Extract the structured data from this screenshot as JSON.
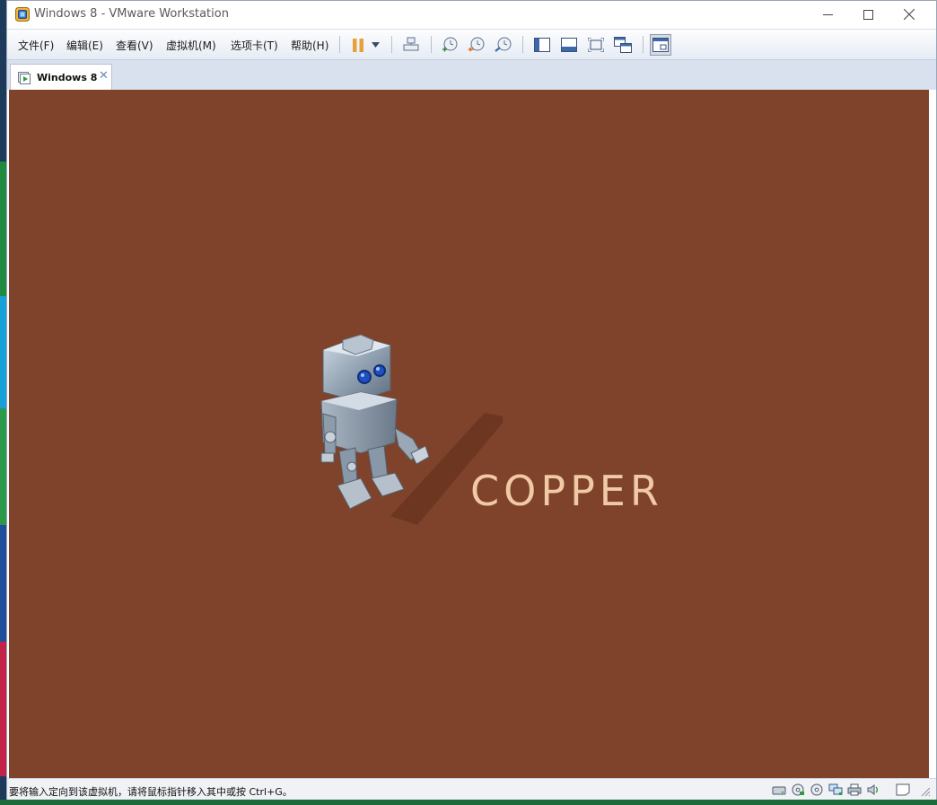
{
  "window": {
    "title": "Windows 8 - VMware Workstation"
  },
  "menu": {
    "items": [
      "文件(F)",
      "编辑(E)",
      "查看(V)",
      "虚拟机(M)",
      "选项卡(T)",
      "帮助(H)"
    ]
  },
  "toolbar": {
    "buttons": [
      {
        "icon": "pause-icon"
      },
      {
        "icon": "dropdown-arrow-icon"
      },
      {
        "icon": "send-ctrl-alt-del-icon"
      },
      {
        "icon": "snapshot-take-icon"
      },
      {
        "icon": "snapshot-revert-icon"
      },
      {
        "icon": "snapshot-manager-icon"
      },
      {
        "icon": "show-library-icon"
      },
      {
        "icon": "thumbnail-bar-icon"
      },
      {
        "icon": "fullscreen-icon"
      },
      {
        "icon": "unity-icon"
      },
      {
        "icon": "console-view-icon"
      }
    ]
  },
  "tabs": [
    {
      "label": "Windows 8",
      "close": "✕"
    }
  ],
  "vm": {
    "brand_text": "COPPER",
    "background": "#7f422a",
    "text_color": "#f0c9a6"
  },
  "status": {
    "message": "要将输入定向到该虚拟机，请将鼠标指针移入其中或按 Ctrl+G。",
    "device_icons": [
      "hard-disk-icon",
      "cd-dvd-icon",
      "cd-dvd-2-icon",
      "network-adapter-icon",
      "printer-icon",
      "sound-card-icon",
      "message-log-icon"
    ]
  },
  "colors": {
    "accent": "#e8a13a",
    "tab_strip": "#d9e1ee"
  }
}
